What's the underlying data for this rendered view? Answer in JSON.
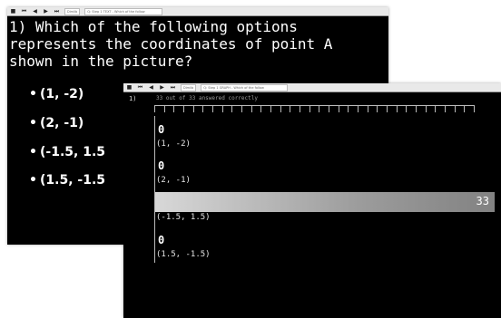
{
  "question_window": {
    "toolbar": {
      "icons": [
        "stop-icon",
        "skip-back-icon",
        "prev-icon",
        "next-icon",
        "skip-end-icon"
      ],
      "zoom": "Dimlib",
      "title_field": "Q: Step 1 TEXT - Which of the follow"
    },
    "question": "1) Which of the following options represents the coordinates of point A shown in the picture?",
    "options": [
      "(1,  -2)",
      "(2,  -1)",
      "(-1.5,  1.5",
      "(1.5,  -1.5"
    ]
  },
  "results_window": {
    "toolbar": {
      "icons": [
        "stop-icon",
        "skip-back-icon",
        "prev-icon",
        "next-icon",
        "skip-end-icon"
      ],
      "zoom": "Dimlib",
      "title_field": "Q: Step 1 GRAPH - Which of the follow"
    },
    "question_number": "1)",
    "summary": "33 out of 33 answered correctly",
    "chart_data": {
      "type": "bar",
      "orientation": "horizontal",
      "categories": [
        "(1, -2)",
        "(2, -1)",
        "(-1.5, 1.5)",
        "(1.5, -1.5)"
      ],
      "values": [
        0,
        0,
        33,
        0
      ],
      "value_labels": [
        "0",
        "0",
        "33",
        "0"
      ],
      "xlim": [
        0,
        33
      ],
      "tick_count": 33
    }
  }
}
